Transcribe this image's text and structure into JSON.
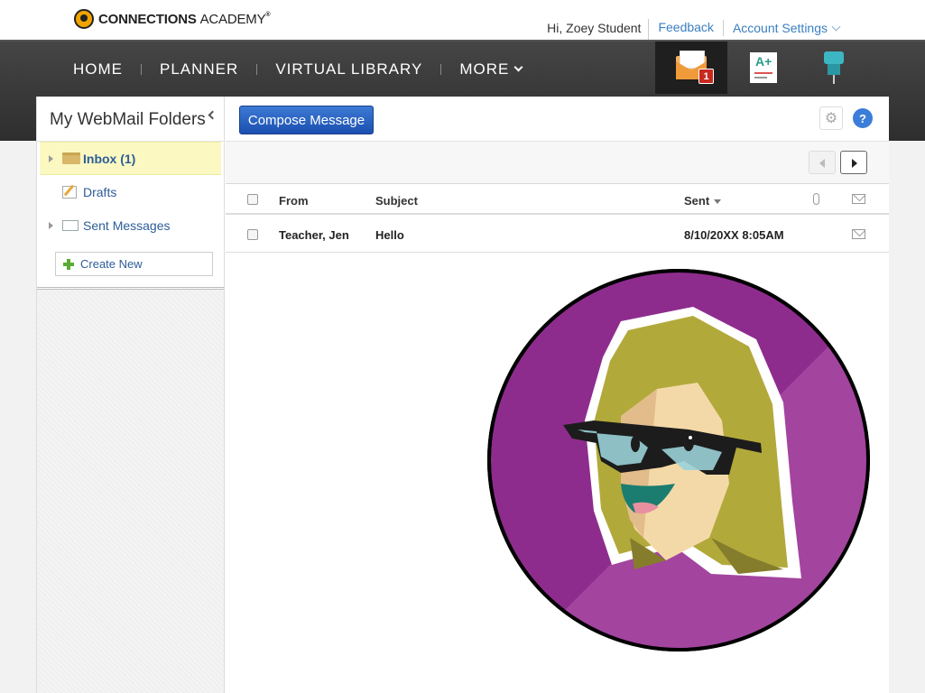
{
  "header": {
    "logo_bold": "CONNECTIONS",
    "logo_light": "ACADEMY",
    "logo_mark": "®",
    "greeting": "Hi, Zoey Student",
    "feedback": "Feedback",
    "account_settings": "Account Settings"
  },
  "nav": {
    "items": [
      "HOME",
      "PLANNER",
      "VIRTUAL LIBRARY",
      "MORE"
    ],
    "tools": [
      {
        "icon": "webmail-icon",
        "badge": "1",
        "active": true
      },
      {
        "icon": "gradebook-icon"
      },
      {
        "icon": "pushpin-icon"
      }
    ],
    "gradebook_letter": "A+"
  },
  "sidebar": {
    "title": "My WebMail Folders",
    "folders": [
      {
        "label": "Inbox (1)",
        "icon": "folder-icon",
        "selected": true
      },
      {
        "label": "Drafts",
        "icon": "drafts-icon"
      },
      {
        "label": "Sent Messages",
        "icon": "sent-icon"
      }
    ],
    "create_new": "Create New"
  },
  "content": {
    "compose": "Compose Message",
    "help": "?",
    "columns": {
      "from": "From",
      "subject": "Subject",
      "sent": "Sent"
    },
    "messages": [
      {
        "from": "Teacher, Jen",
        "subject": "Hello",
        "sent": "8/10/20XX 8:05AM"
      }
    ]
  },
  "colors": {
    "brand_blue": "#2a5fbf",
    "avatar_purple": "#9a3a9a",
    "badge_red": "#c8281d"
  }
}
